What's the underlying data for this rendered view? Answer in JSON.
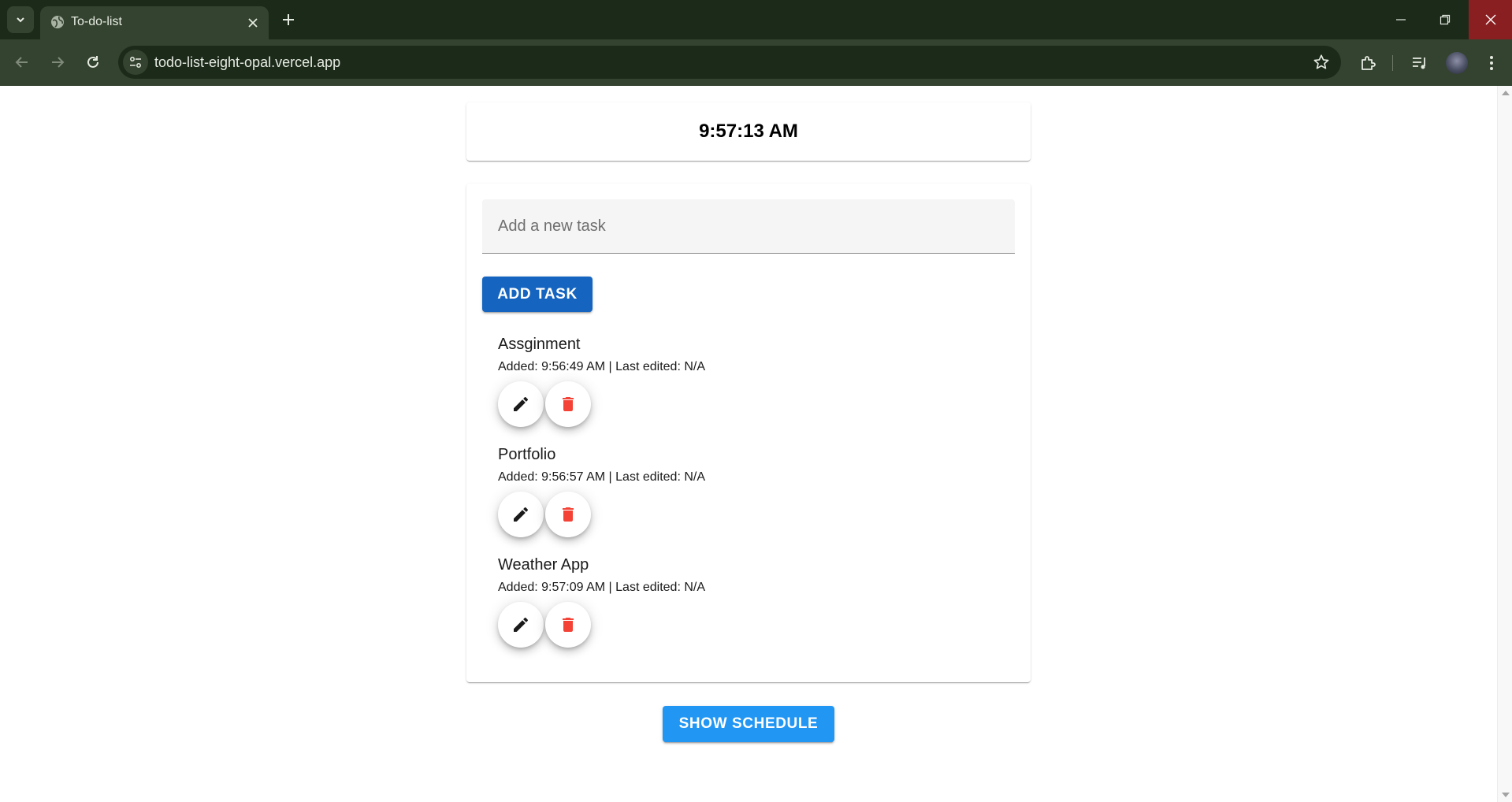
{
  "browser": {
    "tab_title": "To-do-list",
    "url": "todo-list-eight-opal.vercel.app",
    "icons": [
      "tab-search-icon",
      "globe-icon",
      "close-icon",
      "plus-icon",
      "minimize-icon",
      "restore-icon",
      "close-icon",
      "back-icon",
      "forward-icon",
      "reload-icon",
      "site-info-icon",
      "star-icon",
      "extensions-icon",
      "media-icon",
      "avatar",
      "more-icon"
    ]
  },
  "clock": {
    "time": "9:57:13 AM"
  },
  "form": {
    "placeholder": "Add a new task",
    "add_label": "Add Task"
  },
  "tasks": [
    {
      "name": "Assginment",
      "added": "Added: 9:56:49 AM",
      "separator": " | ",
      "edited": "Last edited: N/A"
    },
    {
      "name": "Portfolio",
      "added": "Added: 9:56:57 AM",
      "separator": " | ",
      "edited": "Last edited: N/A"
    },
    {
      "name": "Weather App",
      "added": "Added: 9:57:09 AM",
      "separator": " | ",
      "edited": "Last edited: N/A"
    }
  ],
  "schedule": {
    "label": "Show Schedule"
  },
  "colors": {
    "primary": "#1565c0",
    "secondary": "#2196f3",
    "delete": "#f44336",
    "chrome_dark": "#1c2a1a",
    "chrome_light": "#34432f"
  }
}
